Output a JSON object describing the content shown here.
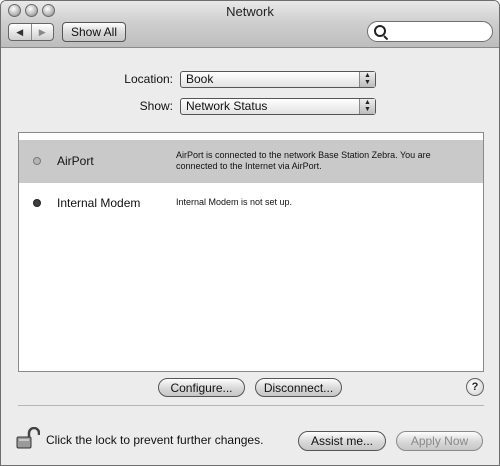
{
  "window": {
    "title": "Network"
  },
  "toolbar": {
    "back_glyph": "◀",
    "forward_glyph": "▶",
    "show_all_label": "Show All",
    "search_placeholder": ""
  },
  "location": {
    "label": "Location:",
    "value": "Book"
  },
  "show": {
    "label": "Show:",
    "value": "Network Status"
  },
  "status_list": [
    {
      "name": "AirPort",
      "description": "AirPort is connected to the network Base Station Zebra. You are connected to the Internet via AirPort.",
      "selected": true,
      "indicator_color": "#b5b5b5"
    },
    {
      "name": "Internal Modem",
      "description": "Internal Modem is not set up.",
      "selected": false,
      "indicator_color": "#3f3f3f"
    }
  ],
  "actions": {
    "configure_label": "Configure...",
    "disconnect_label": "Disconnect...",
    "help_glyph": "?"
  },
  "footer": {
    "lock_text": "Click the lock to prevent further changes.",
    "assist_label": "Assist me...",
    "apply_label": "Apply Now"
  }
}
